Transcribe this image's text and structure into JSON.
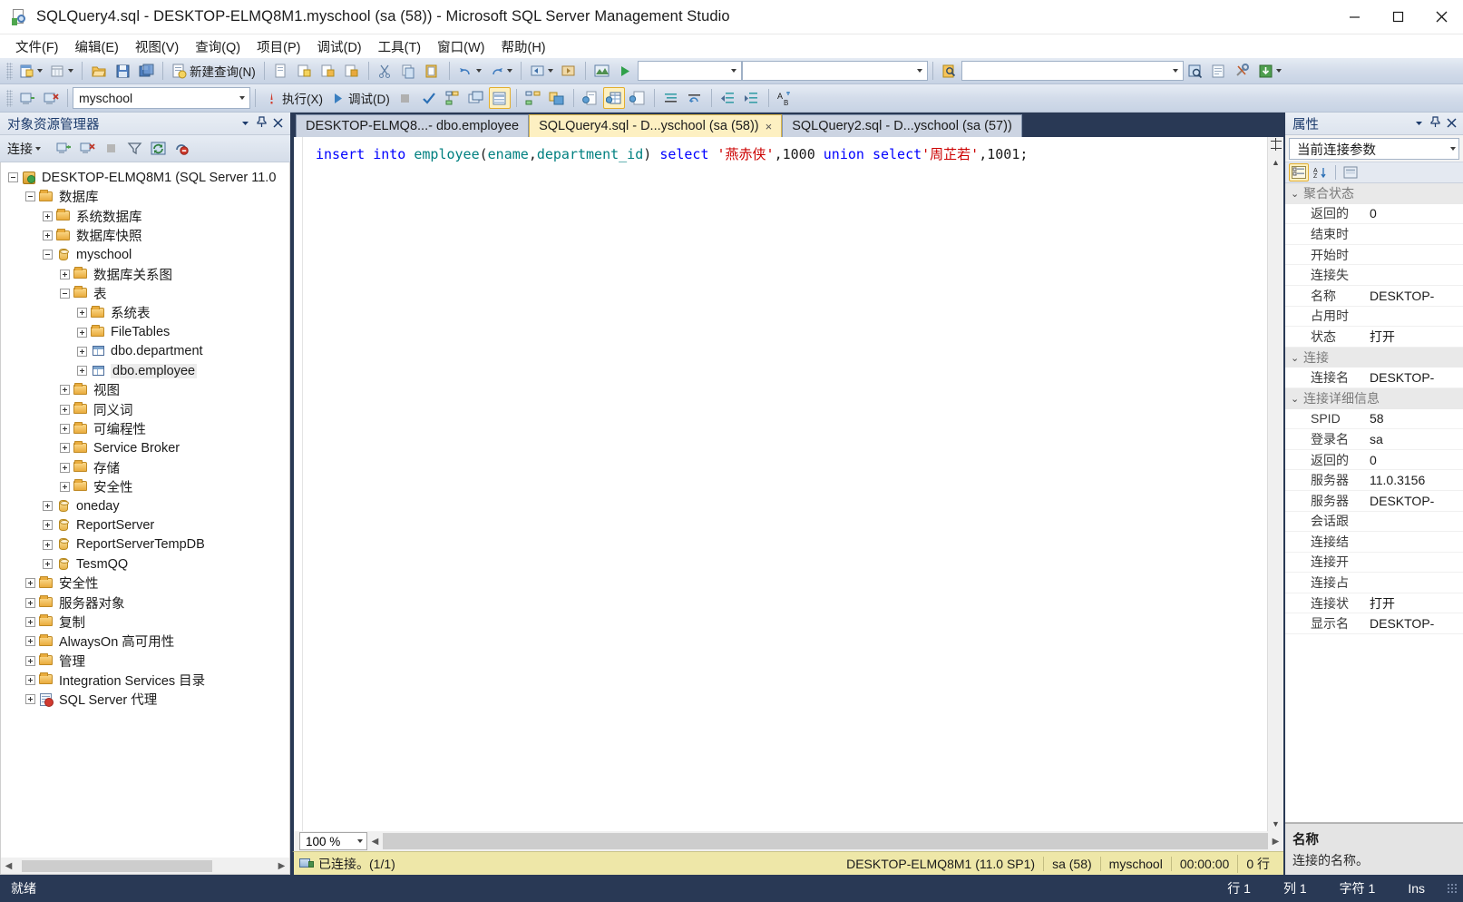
{
  "window": {
    "title": "SQLQuery4.sql - DESKTOP-ELMQ8M1.myschool (sa (58)) - Microsoft SQL Server Management Studio",
    "icon": "ssms-icon",
    "minimize": "minimize-icon",
    "maximize": "maximize-icon",
    "close": "close-icon"
  },
  "menu": {
    "items": [
      {
        "label": "文件(F)"
      },
      {
        "label": "编辑(E)"
      },
      {
        "label": "视图(V)"
      },
      {
        "label": "查询(Q)"
      },
      {
        "label": "项目(P)"
      },
      {
        "label": "调试(D)"
      },
      {
        "label": "工具(T)"
      },
      {
        "label": "窗口(W)"
      },
      {
        "label": "帮助(H)"
      }
    ]
  },
  "toolbar1": {
    "new_query_label": "新建查询(N)",
    "search_value": "",
    "combo1_value": "",
    "combo2_value": ""
  },
  "toolbar2": {
    "database_value": "myschool",
    "execute_label": "执行(X)",
    "debug_label": "调试(D)"
  },
  "object_explorer": {
    "title": "对象资源管理器",
    "connect_label": "连接",
    "tree": [
      {
        "label": "DESKTOP-ELMQ8M1 (SQL Server 11.0",
        "depth": 0,
        "icon": "server-icon",
        "state": "expanded"
      },
      {
        "label": "数据库",
        "depth": 1,
        "icon": "folder-icon",
        "state": "expanded"
      },
      {
        "label": "系统数据库",
        "depth": 2,
        "icon": "folder-icon",
        "state": "collapsed"
      },
      {
        "label": "数据库快照",
        "depth": 2,
        "icon": "folder-icon",
        "state": "collapsed"
      },
      {
        "label": "myschool",
        "depth": 2,
        "icon": "database-icon",
        "state": "expanded"
      },
      {
        "label": "数据库关系图",
        "depth": 3,
        "icon": "folder-icon",
        "state": "collapsed"
      },
      {
        "label": "表",
        "depth": 3,
        "icon": "folder-icon",
        "state": "expanded"
      },
      {
        "label": "系统表",
        "depth": 4,
        "icon": "folder-icon",
        "state": "collapsed"
      },
      {
        "label": "FileTables",
        "depth": 4,
        "icon": "folder-icon",
        "state": "collapsed"
      },
      {
        "label": "dbo.department",
        "depth": 4,
        "icon": "table-icon",
        "state": "collapsed"
      },
      {
        "label": "dbo.employee",
        "depth": 4,
        "icon": "table-icon",
        "state": "collapsed",
        "selected": true
      },
      {
        "label": "视图",
        "depth": 3,
        "icon": "folder-icon",
        "state": "collapsed"
      },
      {
        "label": "同义词",
        "depth": 3,
        "icon": "folder-icon",
        "state": "collapsed"
      },
      {
        "label": "可编程性",
        "depth": 3,
        "icon": "folder-icon",
        "state": "collapsed"
      },
      {
        "label": "Service Broker",
        "depth": 3,
        "icon": "folder-icon",
        "state": "collapsed"
      },
      {
        "label": "存储",
        "depth": 3,
        "icon": "folder-icon",
        "state": "collapsed"
      },
      {
        "label": "安全性",
        "depth": 3,
        "icon": "folder-icon",
        "state": "collapsed"
      },
      {
        "label": "oneday",
        "depth": 2,
        "icon": "database-icon",
        "state": "collapsed"
      },
      {
        "label": "ReportServer",
        "depth": 2,
        "icon": "database-icon",
        "state": "collapsed"
      },
      {
        "label": "ReportServerTempDB",
        "depth": 2,
        "icon": "database-icon",
        "state": "collapsed"
      },
      {
        "label": "TesmQQ",
        "depth": 2,
        "icon": "database-icon",
        "state": "collapsed"
      },
      {
        "label": "安全性",
        "depth": 1,
        "icon": "folder-icon",
        "state": "collapsed"
      },
      {
        "label": "服务器对象",
        "depth": 1,
        "icon": "folder-icon",
        "state": "collapsed"
      },
      {
        "label": "复制",
        "depth": 1,
        "icon": "folder-icon",
        "state": "collapsed"
      },
      {
        "label": "AlwaysOn 高可用性",
        "depth": 1,
        "icon": "folder-icon",
        "state": "collapsed"
      },
      {
        "label": "管理",
        "depth": 1,
        "icon": "folder-icon",
        "state": "collapsed"
      },
      {
        "label": "Integration Services 目录",
        "depth": 1,
        "icon": "folder-icon",
        "state": "collapsed"
      },
      {
        "label": "SQL Server 代理",
        "depth": 1,
        "icon": "agent-icon",
        "state": "collapsed"
      }
    ]
  },
  "tabs": [
    {
      "label": "DESKTOP-ELMQ8...- dbo.employee",
      "active": false,
      "closable": false
    },
    {
      "label": "SQLQuery4.sql - D...yschool (sa (58))",
      "active": true,
      "closable": true,
      "close_label": "×"
    },
    {
      "label": "SQLQuery2.sql - D...yschool (sa (57))",
      "active": false,
      "closable": false
    }
  ],
  "editor": {
    "code_tokens": [
      {
        "t": "insert",
        "c": "kw"
      },
      {
        "t": " ",
        "c": "punct"
      },
      {
        "t": "into",
        "c": "kw"
      },
      {
        "t": " ",
        "c": "punct"
      },
      {
        "t": "employee",
        "c": "ident"
      },
      {
        "t": "(",
        "c": "punct"
      },
      {
        "t": "ename",
        "c": "ident"
      },
      {
        "t": ",",
        "c": "punct"
      },
      {
        "t": "department_id",
        "c": "ident"
      },
      {
        "t": ")",
        "c": "punct"
      },
      {
        "t": " ",
        "c": "punct"
      },
      {
        "t": "select",
        "c": "kw"
      },
      {
        "t": " ",
        "c": "punct"
      },
      {
        "t": "'燕赤侠'",
        "c": "str"
      },
      {
        "t": ",",
        "c": "punct"
      },
      {
        "t": "1000",
        "c": "num"
      },
      {
        "t": " ",
        "c": "punct"
      },
      {
        "t": "union",
        "c": "kw"
      },
      {
        "t": " ",
        "c": "punct"
      },
      {
        "t": "select",
        "c": "kw"
      },
      {
        "t": "'周芷若'",
        "c": "str"
      },
      {
        "t": ",",
        "c": "punct"
      },
      {
        "t": "1001",
        "c": "num"
      },
      {
        "t": ";",
        "c": "punct"
      }
    ],
    "zoom_value": "100 %"
  },
  "connection_bar": {
    "status": "已连接。(1/1)",
    "server": "DESKTOP-ELMQ8M1 (11.0 SP1)",
    "login": "sa (58)",
    "database": "myschool",
    "elapsed": "00:00:00",
    "rows": "0 行"
  },
  "properties": {
    "title": "属性",
    "selector_value": "当前连接参数",
    "groups": [
      {
        "name": "聚合状态",
        "rows": [
          {
            "key": "返回的",
            "value": "0"
          },
          {
            "key": "结束时",
            "value": ""
          },
          {
            "key": "开始时",
            "value": ""
          },
          {
            "key": "连接失",
            "value": ""
          },
          {
            "key": "名称",
            "value": "DESKTOP-"
          },
          {
            "key": "占用时",
            "value": ""
          },
          {
            "key": "状态",
            "value": "打开"
          }
        ]
      },
      {
        "name": "连接",
        "rows": [
          {
            "key": "连接名",
            "value": "DESKTOP-"
          }
        ]
      },
      {
        "name": "连接详细信息",
        "rows": [
          {
            "key": "SPID",
            "value": "58"
          },
          {
            "key": "登录名",
            "value": "sa"
          },
          {
            "key": "返回的",
            "value": "0"
          },
          {
            "key": "服务器",
            "value": "11.0.3156"
          },
          {
            "key": "服务器",
            "value": "DESKTOP-"
          },
          {
            "key": "会话跟",
            "value": ""
          },
          {
            "key": "连接结",
            "value": ""
          },
          {
            "key": "连接开",
            "value": ""
          },
          {
            "key": "连接占",
            "value": ""
          },
          {
            "key": "连接状",
            "value": "打开"
          },
          {
            "key": "显示名",
            "value": "DESKTOP-"
          }
        ]
      }
    ],
    "description_title": "名称",
    "description_text": "连接的名称。"
  },
  "statusbar": {
    "ready": "就绪",
    "line": "行 1",
    "column": "列 1",
    "char": "字符 1",
    "mode": "Ins"
  },
  "colors": {
    "chrome": "#293955",
    "accent_tab": "#fdf0c2",
    "conn_bar": "#eee7a8",
    "keyword": "#0000ff",
    "identifier": "#008080",
    "string": "#cc0000"
  }
}
